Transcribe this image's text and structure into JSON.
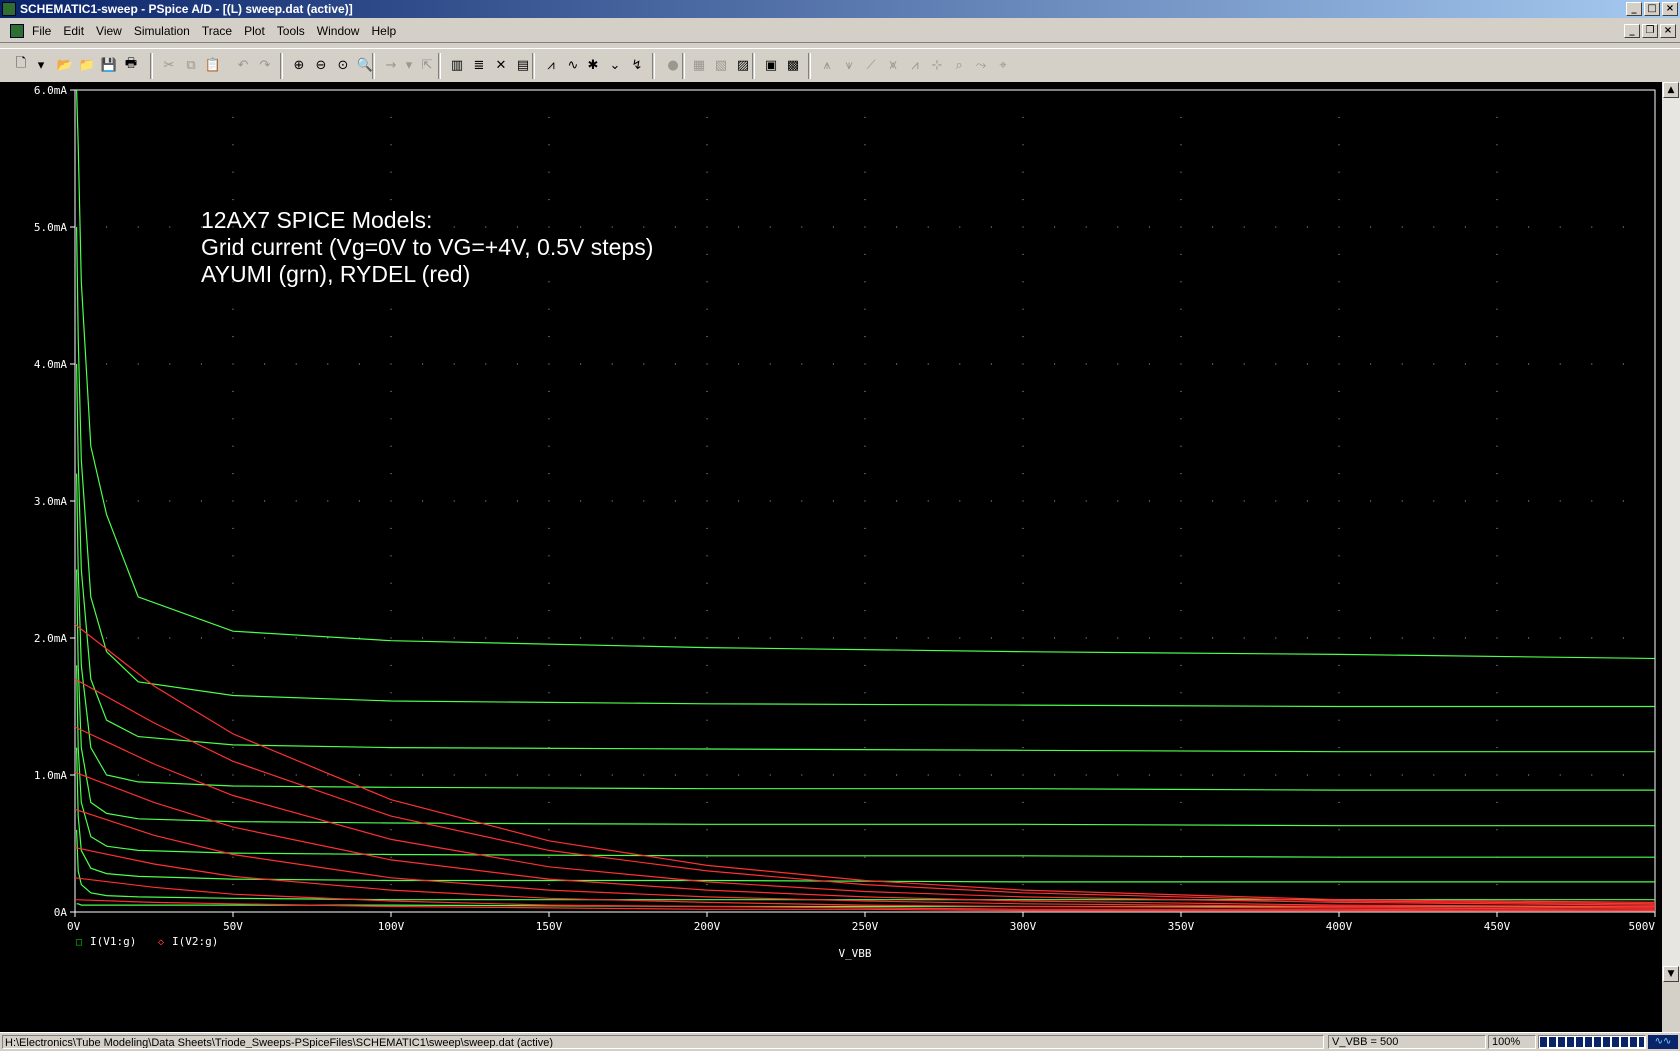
{
  "window": {
    "title": "SCHEMATIC1-sweep - PSpice A/D  - [(L) sweep.dat (active)]"
  },
  "menu": [
    "File",
    "Edit",
    "View",
    "Simulation",
    "Trace",
    "Plot",
    "Tools",
    "Window",
    "Help"
  ],
  "toolbar_icons": [
    "new-icon",
    "dropdown-icon",
    "open-icon",
    "open-file-icon",
    "save-icon",
    "print-icon",
    "cut-icon",
    "copy-icon",
    "paste-icon",
    "undo-icon",
    "redo-icon",
    "zoom-in-icon",
    "zoom-out-icon",
    "zoom-area-icon",
    "zoom-fit-icon",
    "arrow-icon",
    "arrow-dropdown-icon",
    "mark-icon",
    "axis-settings-icon",
    "fourier-icon",
    "cursor-icon",
    "table-icon",
    "add-trace-icon",
    "eval-goal-icon",
    "mark-data-icon",
    "toggle-cursor-icon",
    "snap-icon",
    "stop-icon",
    "log-icon",
    "dual-icon",
    "copy-window-icon",
    "simulation-settings-icon",
    "results-icon",
    "cursor-peak-icon",
    "cursor-trough-icon",
    "cursor-slope-icon",
    "cursor-min-icon",
    "cursor-max-icon",
    "cursor-point-icon",
    "cursor-search-icon",
    "cursor-next-icon",
    "cursor-label-icon"
  ],
  "plot": {
    "annotation": [
      "12AX7 SPICE Models:",
      "Grid current (Vg=0V to VG=+4V, 0.5V steps)",
      "AYUMI (grn), RYDEL (red)"
    ],
    "legend": [
      {
        "label": "I(V1:g)",
        "marker": "□",
        "color": "#00cc00"
      },
      {
        "label": "I(V2:g)",
        "marker": "◇",
        "color": "#ff4040"
      }
    ],
    "colors": {
      "background": "#000000",
      "axis": "#ffffff",
      "grid": "#b0b0b0",
      "green": "#4cff4c",
      "red": "#ff3030"
    }
  },
  "chart_data": {
    "type": "line",
    "xlabel": "V_VBB",
    "xlim": [
      0,
      500
    ],
    "ylim": [
      0,
      6.0
    ],
    "x_ticks": [
      "0V",
      "50V",
      "100V",
      "150V",
      "200V",
      "250V",
      "300V",
      "350V",
      "400V",
      "450V",
      "500V"
    ],
    "y_ticks": [
      "0A",
      "1.0mA",
      "2.0mA",
      "3.0mA",
      "4.0mA",
      "5.0mA",
      "6.0mA"
    ],
    "grid": true,
    "series": [
      {
        "name": "I(V1:g)",
        "color": "#4cff4c",
        "x": [
          0.5,
          1,
          2,
          5,
          10,
          20,
          50,
          100,
          200,
          300,
          400,
          500
        ],
        "curves": [
          [
            0.06,
            0.06,
            0.05,
            0.05,
            0.05,
            0.05,
            0.05,
            0.05,
            0.04,
            0.04,
            0.04,
            0.04
          ],
          [
            0.6,
            0.3,
            0.2,
            0.14,
            0.12,
            0.11,
            0.1,
            0.09,
            0.09,
            0.09,
            0.09,
            0.09
          ],
          [
            1.2,
            0.7,
            0.45,
            0.32,
            0.28,
            0.26,
            0.24,
            0.23,
            0.23,
            0.22,
            0.22,
            0.22
          ],
          [
            1.8,
            1.2,
            0.8,
            0.55,
            0.48,
            0.45,
            0.43,
            0.42,
            0.41,
            0.41,
            0.4,
            0.4
          ],
          [
            2.5,
            1.8,
            1.2,
            0.8,
            0.72,
            0.68,
            0.66,
            0.65,
            0.64,
            0.64,
            0.63,
            0.63
          ],
          [
            3.2,
            2.5,
            1.8,
            1.2,
            1.0,
            0.95,
            0.92,
            0.91,
            0.9,
            0.9,
            0.89,
            0.89
          ],
          [
            4.0,
            3.3,
            2.5,
            1.7,
            1.4,
            1.28,
            1.22,
            1.2,
            1.19,
            1.18,
            1.17,
            1.17
          ],
          [
            5.0,
            4.2,
            3.3,
            2.3,
            1.9,
            1.68,
            1.58,
            1.54,
            1.52,
            1.51,
            1.5,
            1.5
          ],
          [
            6.0,
            5.6,
            4.6,
            3.4,
            2.9,
            2.3,
            2.05,
            1.98,
            1.93,
            1.9,
            1.88,
            1.85
          ]
        ]
      },
      {
        "name": "I(V2:g)",
        "color": "#ff3030",
        "x": [
          0,
          25,
          50,
          100,
          150,
          200,
          250,
          300,
          400,
          500
        ],
        "curves": [
          [
            0.09,
            0.07,
            0.06,
            0.04,
            0.03,
            0.02,
            0.02,
            0.01,
            0.01,
            0.01
          ],
          [
            0.25,
            0.18,
            0.13,
            0.08,
            0.05,
            0.04,
            0.03,
            0.02,
            0.02,
            0.01
          ],
          [
            0.47,
            0.35,
            0.26,
            0.16,
            0.1,
            0.07,
            0.05,
            0.04,
            0.03,
            0.02
          ],
          [
            0.75,
            0.56,
            0.42,
            0.25,
            0.16,
            0.11,
            0.08,
            0.06,
            0.04,
            0.03
          ],
          [
            1.02,
            0.8,
            0.62,
            0.38,
            0.24,
            0.16,
            0.11,
            0.08,
            0.05,
            0.04
          ],
          [
            1.35,
            1.08,
            0.85,
            0.53,
            0.33,
            0.22,
            0.15,
            0.11,
            0.07,
            0.05
          ],
          [
            1.7,
            1.38,
            1.1,
            0.7,
            0.45,
            0.3,
            0.2,
            0.14,
            0.08,
            0.06
          ],
          [
            2.1,
            1.65,
            1.3,
            0.82,
            0.52,
            0.34,
            0.23,
            0.16,
            0.09,
            0.07
          ]
        ]
      }
    ]
  },
  "status": {
    "path": "H:\\Electronics\\Tube Modeling\\Data Sheets\\Triode_Sweeps-PSpiceFiles\\SCHEMATIC1\\sweep\\sweep.dat (active)",
    "sweep": "V_VBB = 500",
    "percent": "100%",
    "progress": 1.0
  }
}
